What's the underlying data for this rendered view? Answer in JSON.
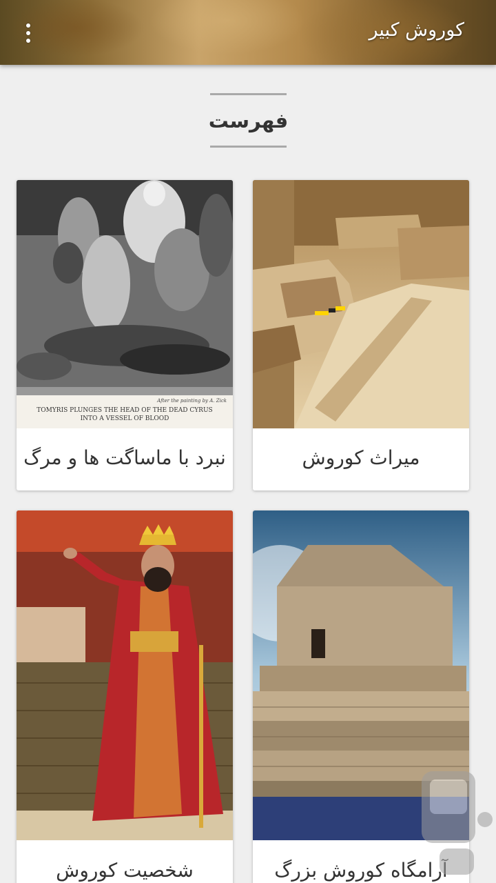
{
  "appbar": {
    "title": "کوروش کبیر",
    "menu_icon": "more-vert-icon"
  },
  "section": {
    "heading": "فهرست"
  },
  "cards": [
    {
      "label": "میراث کوروش",
      "image": "excavation-ruins-photo"
    },
    {
      "label": "نبرد با ماساگت ها و مرگ",
      "image": "tomyris-engraving",
      "engraving_caption": "TOMYRIS PLUNGES THE HEAD OF THE DEAD CYRUS INTO A VESSEL OF BLOOD",
      "engraving_credit": "After the painting by A. Zick"
    },
    {
      "label": "آرامگاه کوروش بزرگ",
      "image": "pasargadae-tomb-photo"
    },
    {
      "label": "شخصیت کوروش",
      "image": "cyrus-illustration"
    }
  ],
  "overlay": {
    "icon": "share-icon"
  }
}
